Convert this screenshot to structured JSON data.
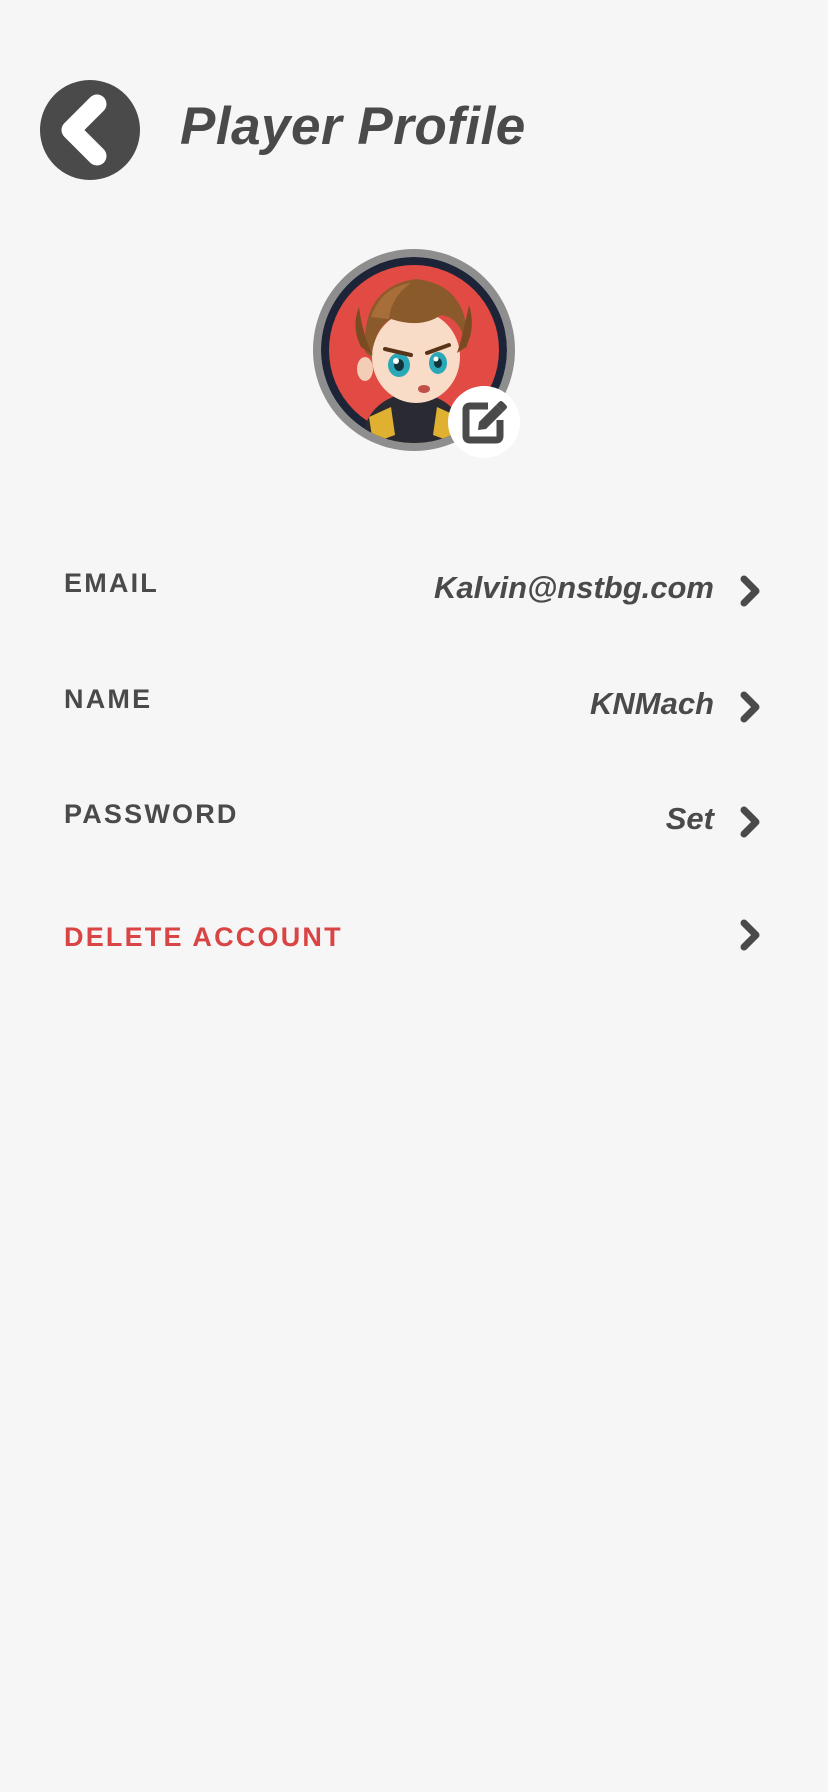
{
  "header": {
    "title": "Player Profile",
    "back_icon": "chevron-left-icon"
  },
  "avatar": {
    "edit_icon": "edit-square-icon",
    "colors": {
      "ring": "#8e8e8e",
      "background": "#e24a44"
    }
  },
  "settings": {
    "email": {
      "label": "EMAIL",
      "value": "Kalvin@nstbg.com"
    },
    "name": {
      "label": "NAME",
      "value": "KNMach"
    },
    "password": {
      "label": "PASSWORD",
      "value": "Set"
    },
    "delete_account": {
      "label": "DELETE ACCOUNT"
    }
  },
  "colors": {
    "background": "#f6f6f6",
    "text": "#4a4a4a",
    "danger": "#d94444"
  }
}
